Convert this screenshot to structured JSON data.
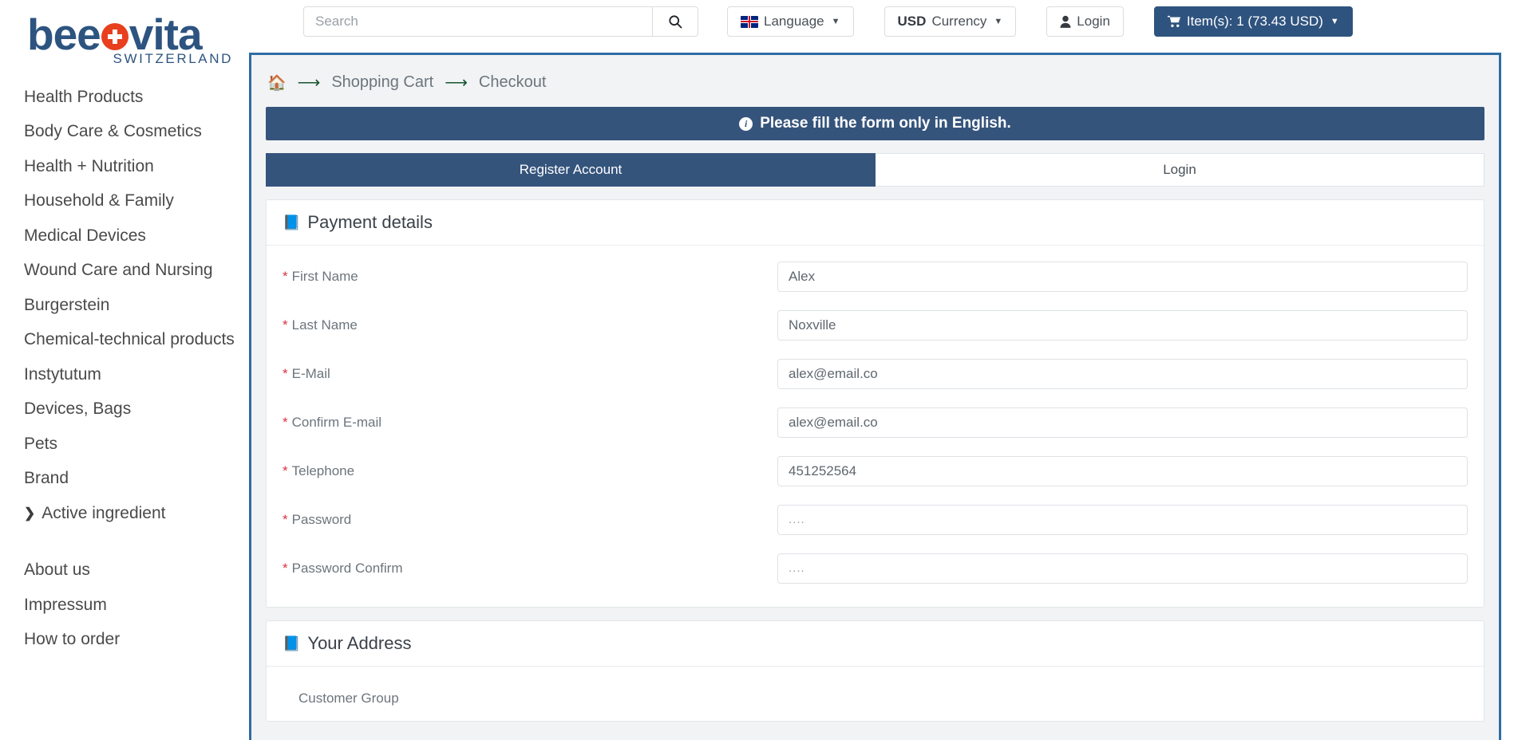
{
  "brand": {
    "name": "beeovita",
    "name_before_mark": "bee",
    "name_after_mark": "vita",
    "tagline": "SWITZERLAND",
    "mark_icon": "swiss-cross-icon",
    "color": "#2d5480"
  },
  "header": {
    "search": {
      "placeholder": "Search",
      "value": "",
      "button_icon": "search-icon"
    },
    "language_button": {
      "label": "Language",
      "flag_icon": "uk-flag-icon",
      "caret_icon": "chevron-down-icon"
    },
    "currency_button": {
      "code": "USD",
      "label": "Currency",
      "caret_icon": "chevron-down-icon"
    },
    "login_button": {
      "label": "Login",
      "icon": "user-icon"
    },
    "cart_button": {
      "label": "Item(s): 1 (73.43 USD)",
      "icon": "shopping-cart-icon",
      "caret_icon": "chevron-down-icon",
      "color": "#2f537f"
    }
  },
  "sidebar": {
    "categories": [
      {
        "label": "Health Products",
        "has_submenu": true
      },
      {
        "label": "Body Care & Cosmetics",
        "has_submenu": true
      },
      {
        "label": "Health + Nutrition",
        "has_submenu": true
      },
      {
        "label": "Household & Family",
        "has_submenu": true
      },
      {
        "label": "Medical Devices",
        "has_submenu": true
      },
      {
        "label": "Wound Care and Nursing",
        "has_submenu": true
      },
      {
        "label": "Burgerstein",
        "has_submenu": false
      },
      {
        "label": "Chemical-technical products",
        "has_submenu": true
      },
      {
        "label": "Instytutum",
        "has_submenu": true
      },
      {
        "label": "Devices, Bags",
        "has_submenu": true
      },
      {
        "label": "Pets",
        "has_submenu": true
      },
      {
        "label": "Brand",
        "has_submenu": true
      }
    ],
    "active_ingredient": {
      "label": "Active ingredient",
      "icon": "chevron-right-icon"
    },
    "footer_links": [
      {
        "label": "About us"
      },
      {
        "label": "Impressum"
      },
      {
        "label": "How to order"
      }
    ]
  },
  "main": {
    "breadcrumb": {
      "home_icon": "home-icon",
      "arrow_icon": "arrow-right-icon",
      "items": [
        {
          "label": "Shopping Cart"
        },
        {
          "label": "Checkout"
        }
      ]
    },
    "alert": {
      "icon": "info-circle-icon",
      "text": "Please fill the form only in English.",
      "background": "#35547c"
    },
    "tabs": [
      {
        "label": "Register Account",
        "active": true
      },
      {
        "label": "Login",
        "active": false
      }
    ],
    "payment_details": {
      "title": "Payment details",
      "icon": "book-icon",
      "fields": [
        {
          "label": "First Name",
          "required": true,
          "value": "Alex",
          "type": "text"
        },
        {
          "label": "Last Name",
          "required": true,
          "value": "Noxville",
          "type": "text"
        },
        {
          "label": "E-Mail",
          "required": true,
          "value": "alex@email.co",
          "type": "email"
        },
        {
          "label": "Confirm E-mail",
          "required": true,
          "value": "alex@email.co",
          "type": "email"
        },
        {
          "label": "Telephone",
          "required": true,
          "value": "451252564",
          "type": "tel"
        },
        {
          "label": "Password",
          "required": true,
          "value": "....",
          "type": "password"
        },
        {
          "label": "Password Confirm",
          "required": true,
          "value": "....",
          "type": "password"
        }
      ]
    },
    "your_address": {
      "title": "Your Address",
      "icon": "book-icon",
      "fields": [
        {
          "label": "Customer Group",
          "required": false
        }
      ]
    }
  }
}
